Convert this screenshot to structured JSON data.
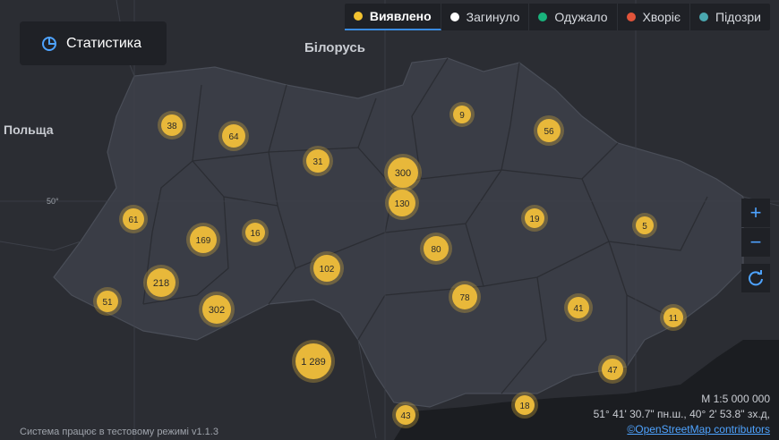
{
  "app": {
    "stat_button": "Статистика"
  },
  "legend": [
    {
      "label": "Виявлено",
      "color": "#f2c230",
      "active": true
    },
    {
      "label": "Загинуло",
      "color": "#ffffff",
      "active": false
    },
    {
      "label": "Одужало",
      "color": "#19b37c",
      "active": false
    },
    {
      "label": "Хворіє",
      "color": "#e2543a",
      "active": false
    },
    {
      "label": "Підозри",
      "color": "#4aa8b0",
      "active": false
    }
  ],
  "map_labels": {
    "belarus": "Білорусь",
    "poland": "Польща",
    "lat": "50°"
  },
  "clusters": [
    {
      "value": "38"
    },
    {
      "value": "64"
    },
    {
      "value": "31"
    },
    {
      "value": "300"
    },
    {
      "value": "130"
    },
    {
      "value": "9"
    },
    {
      "value": "56"
    },
    {
      "value": "61"
    },
    {
      "value": "169"
    },
    {
      "value": "16"
    },
    {
      "value": "80"
    },
    {
      "value": "19"
    },
    {
      "value": "5"
    },
    {
      "value": "218"
    },
    {
      "value": "102"
    },
    {
      "value": "51"
    },
    {
      "value": "302"
    },
    {
      "value": "78"
    },
    {
      "value": "41"
    },
    {
      "value": "11"
    },
    {
      "value": "1 289"
    },
    {
      "value": "47"
    },
    {
      "value": "18"
    },
    {
      "value": "43"
    }
  ],
  "controls": {
    "zoom_in": "+",
    "zoom_out": "−"
  },
  "scale": "М 1:5 000 000",
  "coords": "51° 41' 30.7\" пн.ш., 40° 2' 53.8\" зх.д,",
  "attribution": "©OpenStreetMap contributors",
  "system_note": "Система працює в тестовому режимі v1.1.3",
  "colors": {
    "cluster": "#e8b83a",
    "region": "#3a3d46",
    "background": "#2b2d33"
  }
}
